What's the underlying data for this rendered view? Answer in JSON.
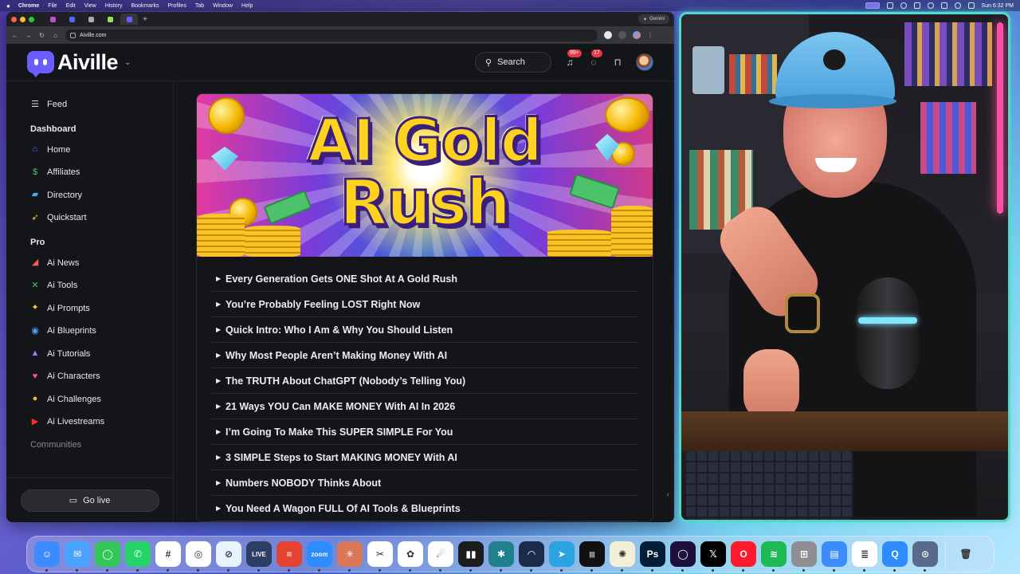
{
  "menubar": {
    "items": [
      "Chrome",
      "File",
      "Edit",
      "View",
      "History",
      "Bookmarks",
      "Profiles",
      "Tab",
      "Window",
      "Help"
    ],
    "clock": "Sun 6:32 PM"
  },
  "browser": {
    "gemini_label": "Gemini",
    "url": "Aiville.com",
    "tabs": [
      {
        "color": "#c04fd6",
        "active": false
      },
      {
        "color": "#4b6bff",
        "active": false
      },
      {
        "color": "#aaaaaa",
        "active": false
      },
      {
        "color": "#9be15d",
        "active": false
      },
      {
        "color": "#6a5cff",
        "active": true
      }
    ]
  },
  "header": {
    "brand": "Aiville",
    "search_label": "Search",
    "notifications_count": "99+",
    "messages_count": "17"
  },
  "sidebar": {
    "feed": {
      "label": "Feed",
      "icon": "feed-icon"
    },
    "dashboard_heading": "Dashboard",
    "dashboard_items": [
      {
        "label": "Home",
        "icon": "house-icon",
        "glyph": "⌂",
        "color": "#4a7dff"
      },
      {
        "label": "Affiliates",
        "icon": "money-bag-icon",
        "glyph": "$",
        "color": "#43c56b"
      },
      {
        "label": "Directory",
        "icon": "folder-icon",
        "glyph": "▰",
        "color": "#3fb7e8"
      },
      {
        "label": "Quickstart",
        "icon": "rocket-icon",
        "glyph": "➶",
        "color": "#ffc83a"
      }
    ],
    "pro_heading": "Pro",
    "pro_items": [
      {
        "label": "Ai News",
        "icon": "megaphone-icon",
        "glyph": "◢",
        "color": "#ff5a5a"
      },
      {
        "label": "Ai Tools",
        "icon": "tools-icon",
        "glyph": "✕",
        "color": "#43c56b"
      },
      {
        "label": "Ai Prompts",
        "icon": "sparkles-icon",
        "glyph": "✦",
        "color": "#ffd23a"
      },
      {
        "label": "Ai Blueprints",
        "icon": "lightbulb-icon",
        "glyph": "◉",
        "color": "#4aa3ff"
      },
      {
        "label": "Ai Tutorials",
        "icon": "teacher-icon",
        "glyph": "▲",
        "color": "#9b7bff"
      },
      {
        "label": "Ai Characters",
        "icon": "heart-icon",
        "glyph": "♥",
        "color": "#ff4fa5"
      },
      {
        "label": "Ai Challenges",
        "icon": "medal-icon",
        "glyph": "●",
        "color": "#ffb02e"
      },
      {
        "label": "Ai Livestreams",
        "icon": "youtube-icon",
        "glyph": "▶",
        "color": "#ff2a2a"
      }
    ],
    "cut_heading": "Communities",
    "go_live": "Go live"
  },
  "hero": {
    "line1": "AI Gold",
    "line2": "Rush"
  },
  "chapters": [
    "Every Generation Gets ONE Shot At A Gold Rush",
    "You’re Probably Feeling LOST Right Now",
    "Quick Intro: Who I Am & Why You Should Listen",
    "Why Most People Aren’t Making Money With AI",
    "The TRUTH About ChatGPT (Nobody’s Telling You)",
    "21 Ways YOU Can MAKE MONEY With AI In 2026",
    "I’m Going To Make This SUPER SIMPLE For You",
    "3 SIMPLE Steps to Start MAKING MONEY With AI",
    "Numbers NOBODY Thinks About",
    "You Need A Wagon FULL Of AI Tools & Blueprints"
  ],
  "dock": [
    {
      "name": "finder-icon",
      "bg": "#3d8cff",
      "glyph": "☺"
    },
    {
      "name": "mail-icon",
      "bg": "#4aa3ff",
      "glyph": "✉"
    },
    {
      "name": "messages-icon",
      "bg": "#34c759",
      "glyph": "◯"
    },
    {
      "name": "whatsapp-icon",
      "bg": "#25d366",
      "glyph": "✆"
    },
    {
      "name": "slack-icon",
      "bg": "#ffffff",
      "glyph": "#"
    },
    {
      "name": "chrome-icon",
      "bg": "#ffffff",
      "glyph": "◎"
    },
    {
      "name": "safari-icon",
      "bg": "#e8f3ff",
      "glyph": "⊘"
    },
    {
      "name": "live-app-icon",
      "bg": "#2d3e66",
      "glyph": "LIVE"
    },
    {
      "name": "todoist-icon",
      "bg": "#e44332",
      "glyph": "≡"
    },
    {
      "name": "zoom-icon",
      "bg": "#2d8cff",
      "glyph": "zoom"
    },
    {
      "name": "claude-icon",
      "bg": "#d97757",
      "glyph": "✳"
    },
    {
      "name": "capcut-icon",
      "bg": "#ffffff",
      "glyph": "✂"
    },
    {
      "name": "chatgpt-icon",
      "bg": "#ffffff",
      "glyph": "✿"
    },
    {
      "name": "grok-icon",
      "bg": "#ffffff",
      "glyph": "☄"
    },
    {
      "name": "audio-icon",
      "bg": "#1c1c1e",
      "glyph": "▮▮"
    },
    {
      "name": "perplexity-icon",
      "bg": "#20808d",
      "glyph": "✱"
    },
    {
      "name": "wave-app-icon",
      "bg": "#1d2b4a",
      "glyph": "◠"
    },
    {
      "name": "telegram-icon",
      "bg": "#2aa3e0",
      "glyph": "➤"
    },
    {
      "name": "waveform-icon",
      "bg": "#111111",
      "glyph": "|||"
    },
    {
      "name": "pineapple-icon",
      "bg": "#f4f0d8",
      "glyph": "✺"
    },
    {
      "name": "photoshop-icon",
      "bg": "#001e36",
      "glyph": "Ps"
    },
    {
      "name": "orb-icon",
      "bg": "#1e0f3a",
      "glyph": "◯"
    },
    {
      "name": "x-icon",
      "bg": "#000000",
      "glyph": "𝕏"
    },
    {
      "name": "opera-icon",
      "bg": "#ff1b2d",
      "glyph": "O"
    },
    {
      "name": "spotify-icon",
      "bg": "#1db954",
      "glyph": "≋"
    },
    {
      "name": "calculator-icon",
      "bg": "#8e8e93",
      "glyph": "⊞"
    },
    {
      "name": "files-icon",
      "bg": "#3d8cff",
      "glyph": "▤"
    },
    {
      "name": "notes-icon",
      "bg": "#ffffff",
      "glyph": "≣"
    },
    {
      "name": "q-app-icon",
      "bg": "#2d8cff",
      "glyph": "Q"
    },
    {
      "name": "disk-utility-icon",
      "bg": "#5a6a8a",
      "glyph": "⊙"
    },
    {
      "name": "trash-icon",
      "bg": "transparent",
      "glyph": "🗑"
    }
  ]
}
